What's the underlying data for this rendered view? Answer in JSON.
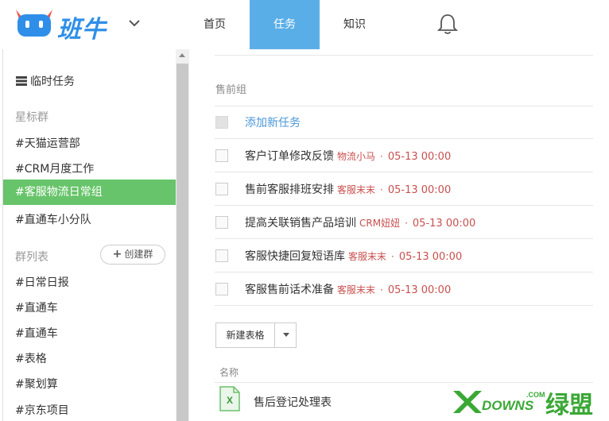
{
  "app": {
    "brand": "班牛"
  },
  "nav": {
    "items": [
      {
        "label": "首页",
        "active": false
      },
      {
        "label": "任务",
        "active": true
      },
      {
        "label": "知识",
        "active": false
      }
    ]
  },
  "sidebar": {
    "temp_tasks": "临时任务",
    "starred_section": "星标群",
    "starred": [
      "#天猫运营部",
      "#CRM月度工作",
      "#客服物流日常组",
      "#直通车小分队"
    ],
    "active_index": 2,
    "group_list_section": "群列表",
    "create_group": "创建群",
    "groups": [
      "#日常日报",
      "#直通车",
      "#直通车",
      "#表格",
      "#聚划算",
      "#京东项目"
    ]
  },
  "main": {
    "group_title": "售前组",
    "add_task": "添加新任务",
    "tasks": [
      {
        "title": "客户订单修改反馈",
        "assignee": "物流小马",
        "separator": "·",
        "due": "05-13 00:00"
      },
      {
        "title": "售前客服排班安排",
        "assignee": "客服末末",
        "separator": "·",
        "due": "05-13 00:00"
      },
      {
        "title": "提高关联销售产品培训",
        "assignee": "CRM妞妞",
        "separator": "·",
        "due": "05-13 00:00"
      },
      {
        "title": "客服快捷回复短语库",
        "assignee": "客服末末",
        "separator": "·",
        "due": "05-13 00:00"
      },
      {
        "title": "客服售前话术准备",
        "assignee": "客服末末",
        "separator": "·",
        "due": "05-13 00:00"
      }
    ],
    "new_table_button": "新建表格",
    "column_name": "名称",
    "files": [
      {
        "name": "售后登记处理表"
      }
    ]
  },
  "watermark": {
    "text_left": "DOWNS",
    "text_small": ".COM",
    "text_right": "绿盟"
  },
  "colors": {
    "accent_blue": "#5aaee8",
    "active_green": "#67c46a",
    "assignee_red": "#c8504e",
    "link_blue": "#4a96d6"
  }
}
